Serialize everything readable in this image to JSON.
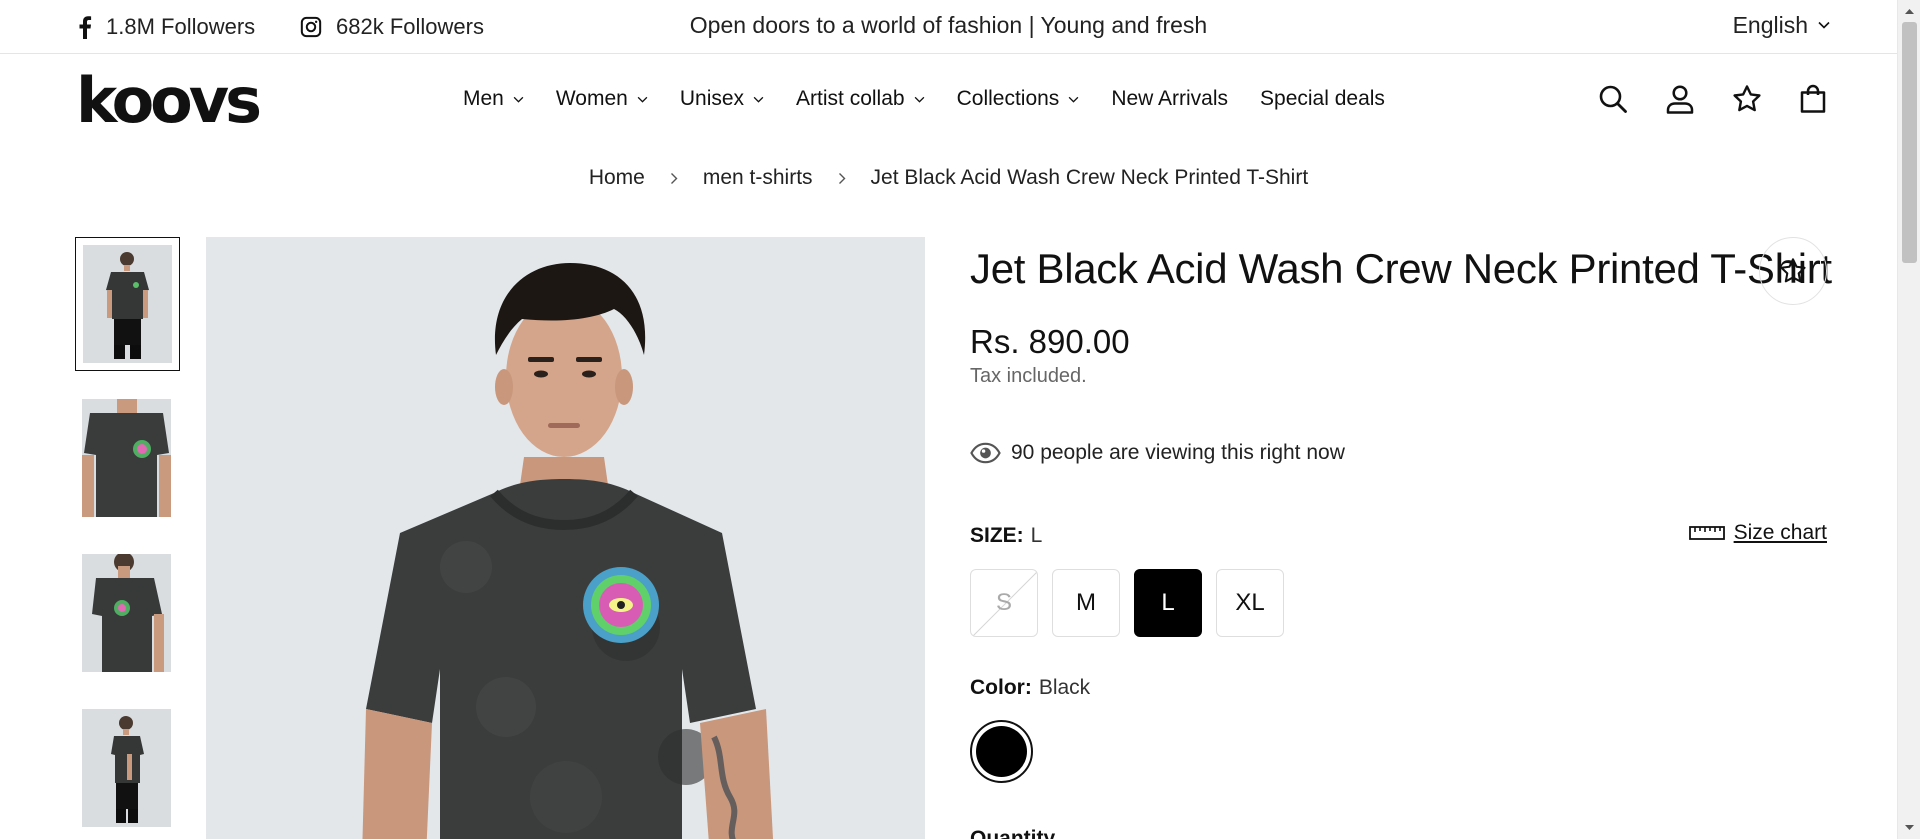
{
  "announcement": {
    "facebook_followers": "1.8M Followers",
    "instagram_followers": "682k Followers",
    "message": "Open doors to a world of fashion | Young and fresh",
    "language": "English"
  },
  "header": {
    "logo": "koovs",
    "nav": [
      {
        "label": "Men",
        "has_dropdown": true
      },
      {
        "label": "Women",
        "has_dropdown": true
      },
      {
        "label": "Unisex",
        "has_dropdown": true
      },
      {
        "label": "Artist collab",
        "has_dropdown": true
      },
      {
        "label": "Collections",
        "has_dropdown": true
      },
      {
        "label": "New Arrivals",
        "has_dropdown": false
      },
      {
        "label": "Special deals",
        "has_dropdown": false
      }
    ],
    "icons": [
      "search-icon",
      "account-icon",
      "wishlist-icon",
      "cart-icon"
    ]
  },
  "breadcrumb": [
    "Home",
    "men t-shirts",
    "Jet Black Acid Wash Crew Neck Printed T-Shirt"
  ],
  "product": {
    "title": "Jet Black Acid Wash Crew Neck Printed T-Shirt",
    "price": "Rs. 890.00",
    "tax_note": "Tax included.",
    "viewers": "90 people are viewing this right now",
    "size_label": "SIZE:",
    "size_selected": "L",
    "size_chart": "Size chart",
    "sizes": [
      {
        "label": "S",
        "available": false,
        "selected": false
      },
      {
        "label": "M",
        "available": true,
        "selected": false
      },
      {
        "label": "L",
        "available": true,
        "selected": true
      },
      {
        "label": "XL",
        "available": true,
        "selected": false
      }
    ],
    "color_label": "Color:",
    "color_selected": "Black",
    "color_swatch": "#000000",
    "quantity_label": "Quantity"
  },
  "gallery": {
    "thumbnail_count": 4,
    "active_thumbnail": 1
  },
  "colors": {
    "text": "#111111",
    "muted": "#666666",
    "border": "#dedede",
    "selected_bg": "#000000",
    "image_bg": "#e3e7ea"
  }
}
